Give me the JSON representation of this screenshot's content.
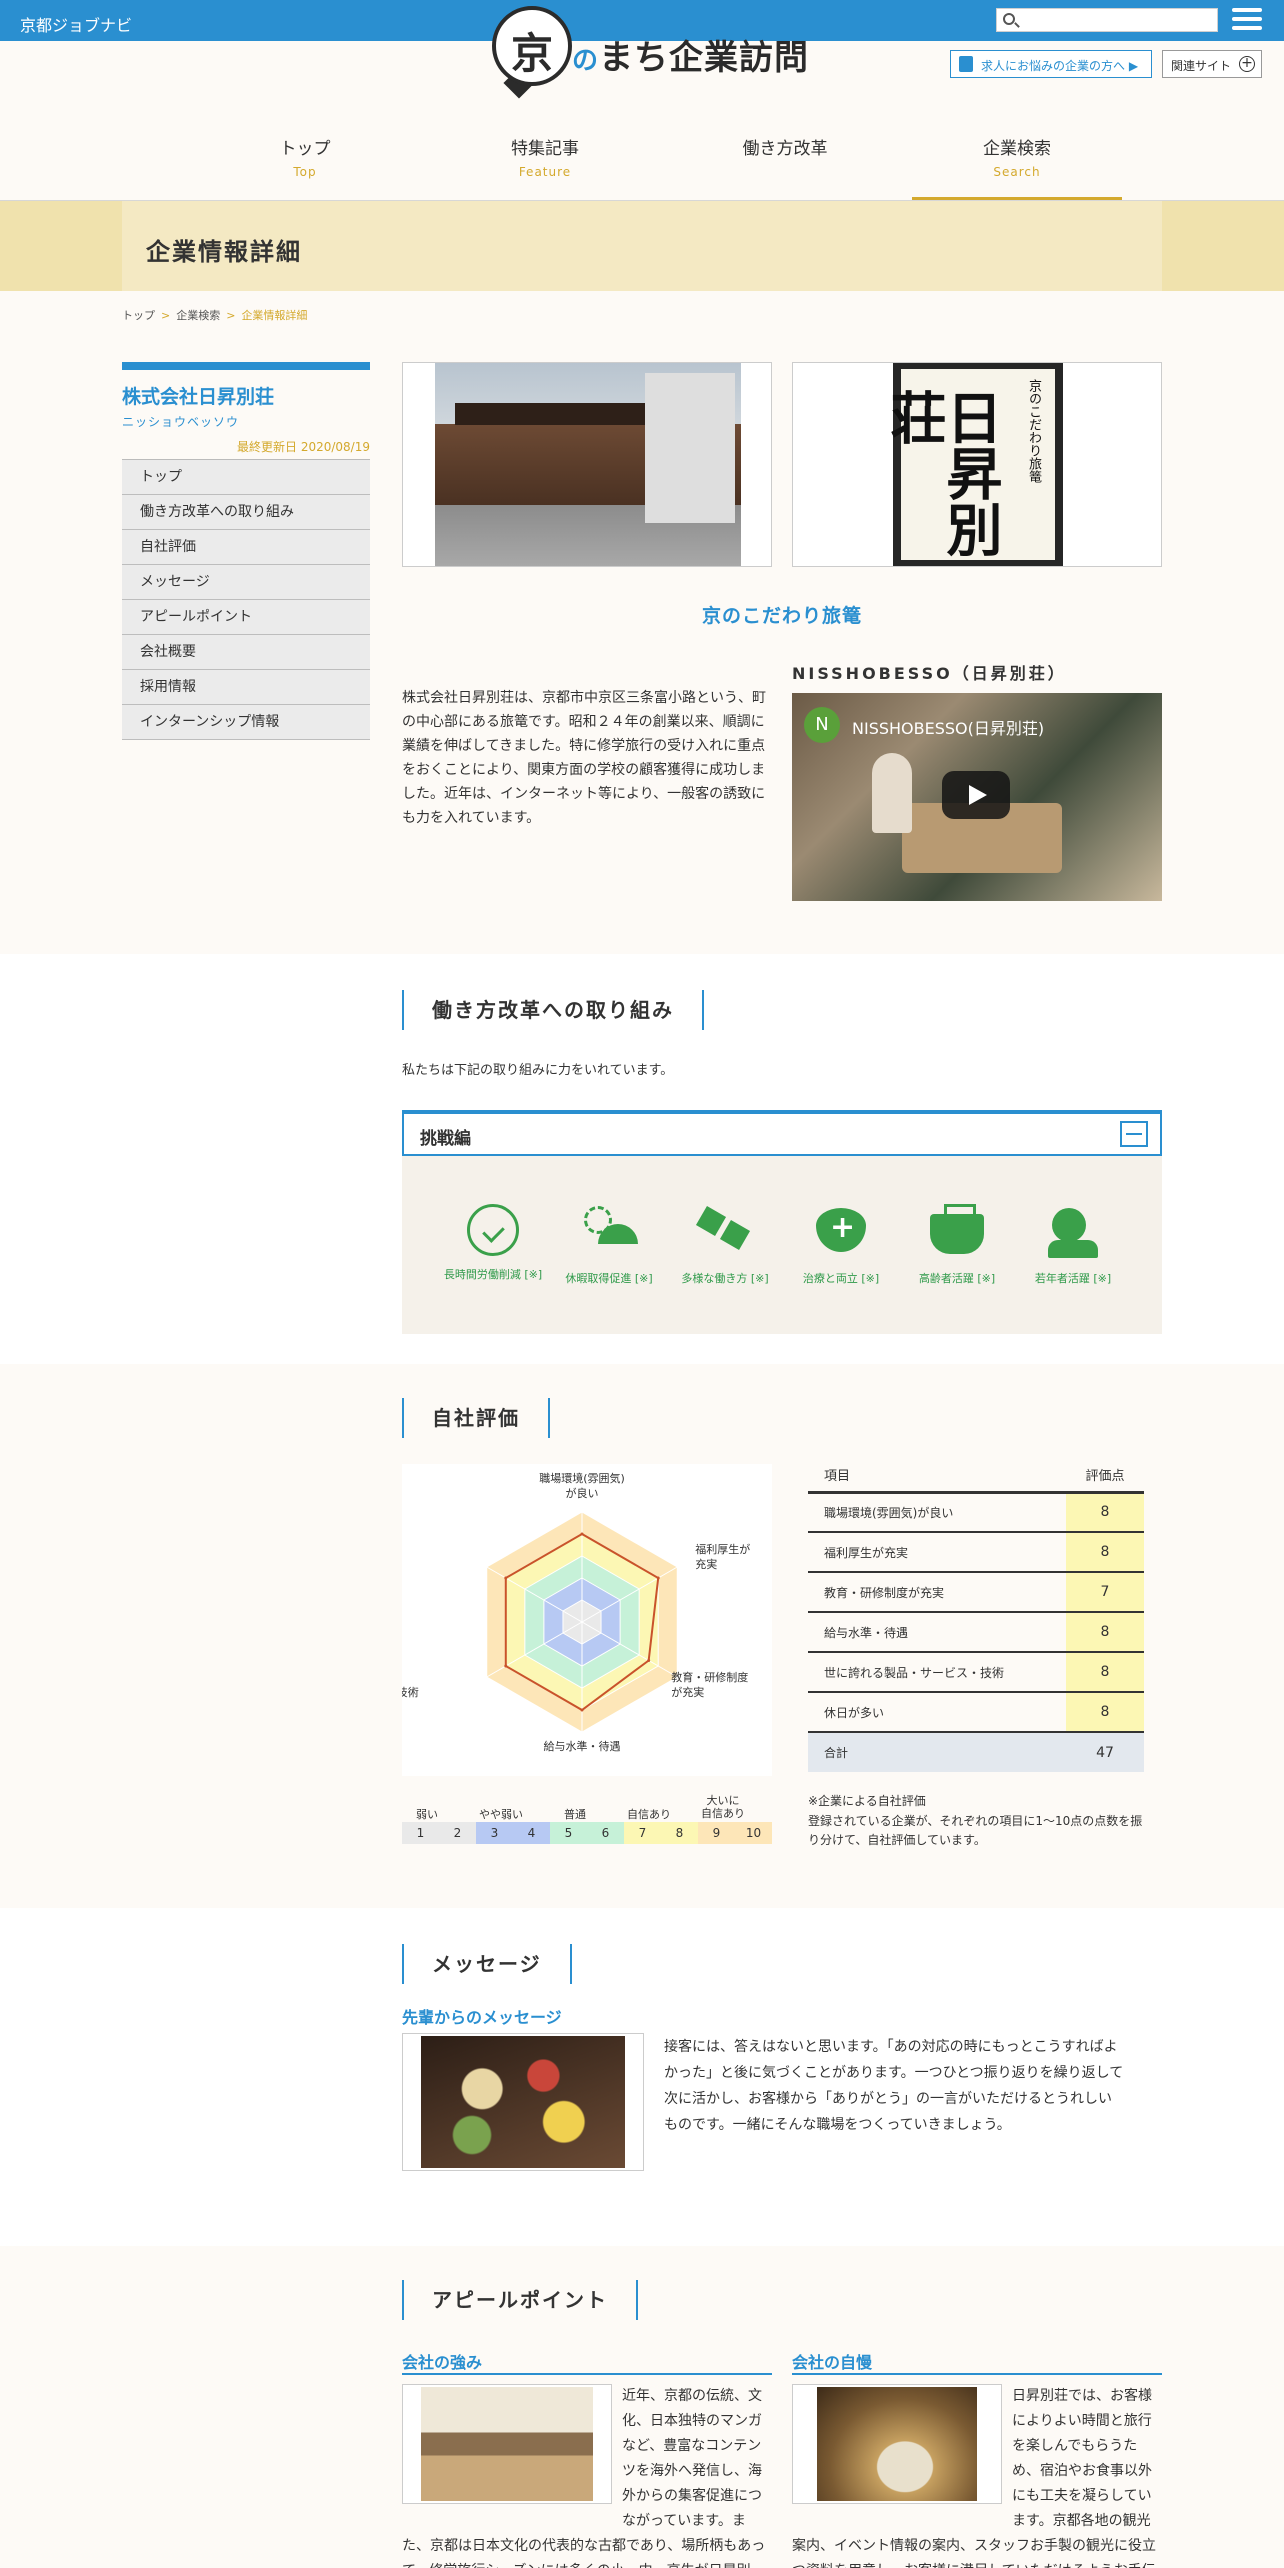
{
  "header": {
    "site_name": "京都ジョブナビ",
    "search_placeholder": "",
    "logo_kanji": "京",
    "logo_no": "の",
    "logo_text": "まち企業訪問",
    "recruit_button": "求人にお悩みの企業の方へ ▶",
    "related_button": "関連サイト",
    "related_plus": "+"
  },
  "nav": [
    {
      "jp": "トップ",
      "en": "Top"
    },
    {
      "jp": "特集記事",
      "en": "Feature"
    },
    {
      "jp": "働き方改革",
      "en": ""
    },
    {
      "jp": "企業検索",
      "en": "Search"
    }
  ],
  "page_title": "企業情報詳細",
  "breadcrumb": {
    "items": [
      "トップ",
      "企業検索"
    ],
    "current": "企業情報詳細",
    "sep": ">"
  },
  "sidebar": {
    "company": "株式会社日昇別荘",
    "kana": "ニッショウベッソウ",
    "updated": "最終更新日 2020/08/19",
    "menu": [
      "トップ",
      "働き方改革への取り組み",
      "自社評価",
      "メッセージ",
      "アピールポイント",
      "会社概要",
      "採用情報",
      "インターンシップ情報"
    ]
  },
  "scroll": {
    "small": "京のこだわり旅篭",
    "big": "日昇別荘"
  },
  "catch": "京のこだわり旅篭",
  "description": "株式会社日昇別荘は、京都市中京区三条富小路という、町の中心部にある旅篭です。昭和２４年の創業以来、順調に業績を伸ばしてきました。特に修学旅行の受け入れに重点をおくことにより、関東方面の学校の顧客獲得に成功しました。近年は、インターネット等により、一般客の誘致にも力を入れています。",
  "video": {
    "heading": "NISSHOBESSO（日昇別荘）",
    "channel_initial": "N",
    "title": "NISSHOBESSO(日昇別荘)"
  },
  "work_reform": {
    "heading": "働き方改革への取り組み",
    "intro": "私たちは下記の取り組みに力をいれています。",
    "panel": "挑戦編",
    "features": [
      "長時間労働削減 [※]",
      "休暇取得促進 [※]",
      "多様な働き方 [※]",
      "治療と両立 [※]",
      "高齢者活躍 [※]",
      "若年者活躍 [※]"
    ],
    "icons": [
      "clock-check-icon",
      "beach-umbrella-icon",
      "hexagons-icon",
      "heart-plus-icon",
      "raised-hands-icon",
      "young-person-icon"
    ],
    "accent": "#3aa04a"
  },
  "evaluation": {
    "heading": "自社評価",
    "table_head": {
      "item": "項目",
      "point": "評価点"
    },
    "rows": [
      {
        "item": "職場環境(雰囲気)が良い",
        "point": "8"
      },
      {
        "item": "福利厚生が充実",
        "point": "8"
      },
      {
        "item": "教育・研修制度が充実",
        "point": "7"
      },
      {
        "item": "給与水準・待遇",
        "point": "8"
      },
      {
        "item": "世に誇れる製品・サービス・技術",
        "point": "8"
      },
      {
        "item": "休日が多い",
        "point": "8"
      }
    ],
    "total": {
      "label": "合計",
      "value": "47"
    },
    "note_title": "※企業による自社評価",
    "note_body": "登録されている企業が、それぞれの項目に1〜10点の点数を振り分けて、自社評価しています。",
    "scale_labels": [
      "弱い",
      "やや弱い",
      "普通",
      "自信あり",
      "大いに\n自信あり"
    ],
    "scale_cells": [
      "1",
      "2",
      "3",
      "4",
      "5",
      "6",
      "7",
      "8",
      "9",
      "10"
    ],
    "scale_colors": [
      "#e9e9e9",
      "#e9e9e9",
      "#b7c9f3",
      "#b7c9f3",
      "#c6f1d8",
      "#c6f1d8",
      "#fcf7b4",
      "#fcf7b4",
      "#fde6b8",
      "#fde6b8"
    ]
  },
  "chart_data": {
    "type": "radar",
    "axes": [
      "職場環境(雰囲気)\nが良い",
      "福利厚生が\n充実",
      "教育・研修制度\nが充実",
      "給与水準・待遇",
      "世に誇れる\n製品・サービス・技術",
      "休日が多い"
    ],
    "values": [
      8,
      8,
      7,
      8,
      8,
      8
    ],
    "range": [
      0,
      10
    ],
    "ring_colors": [
      "#fde6b8",
      "#fcf7b4",
      "#c6f1d8",
      "#b7c9f3",
      "#e9e9e9"
    ],
    "line_color": "#c9532b"
  },
  "message": {
    "heading": "メッセージ",
    "sub": "先輩からのメッセージ",
    "text": "接客には、答えはないと思います。「あの対応の時にもっとこうすればよかった」と後に気づくことがあります。一つひとつ振り返りを繰り返して次に活かし、お客様から「ありがとう」の一言がいただけるとうれしいものです。一緒にそんな職場をつくっていきましょう。"
  },
  "appeal": {
    "heading": "アピールポイント",
    "left_title": "会社の強み",
    "left_text": "近年、京都の伝統、文化、日本独特のマンガなど、豊富なコンテンツを海外へ発信し、海外からの集客促進につながっています。また、京都は日本文化の代表的な古都であり、場所柄もあって、修学旅行シーズンには多くの小・中・高生が日昇別",
    "right_title": "会社の自慢",
    "right_text": "日昇別荘では、お客様によりよい時間と旅行を楽しんでもらうため、宿泊やお食事以外にも工夫を凝らしています。京都各地の観光案内、イベント情報の案内、スタッフお手製の観光に役立つ資料を用意し、お客様に満足していただけるようお手伝いしています。"
  },
  "colors": {
    "primary": "#2a8fd0",
    "gold": "#d4a92d",
    "band": "#f0e2ad"
  }
}
